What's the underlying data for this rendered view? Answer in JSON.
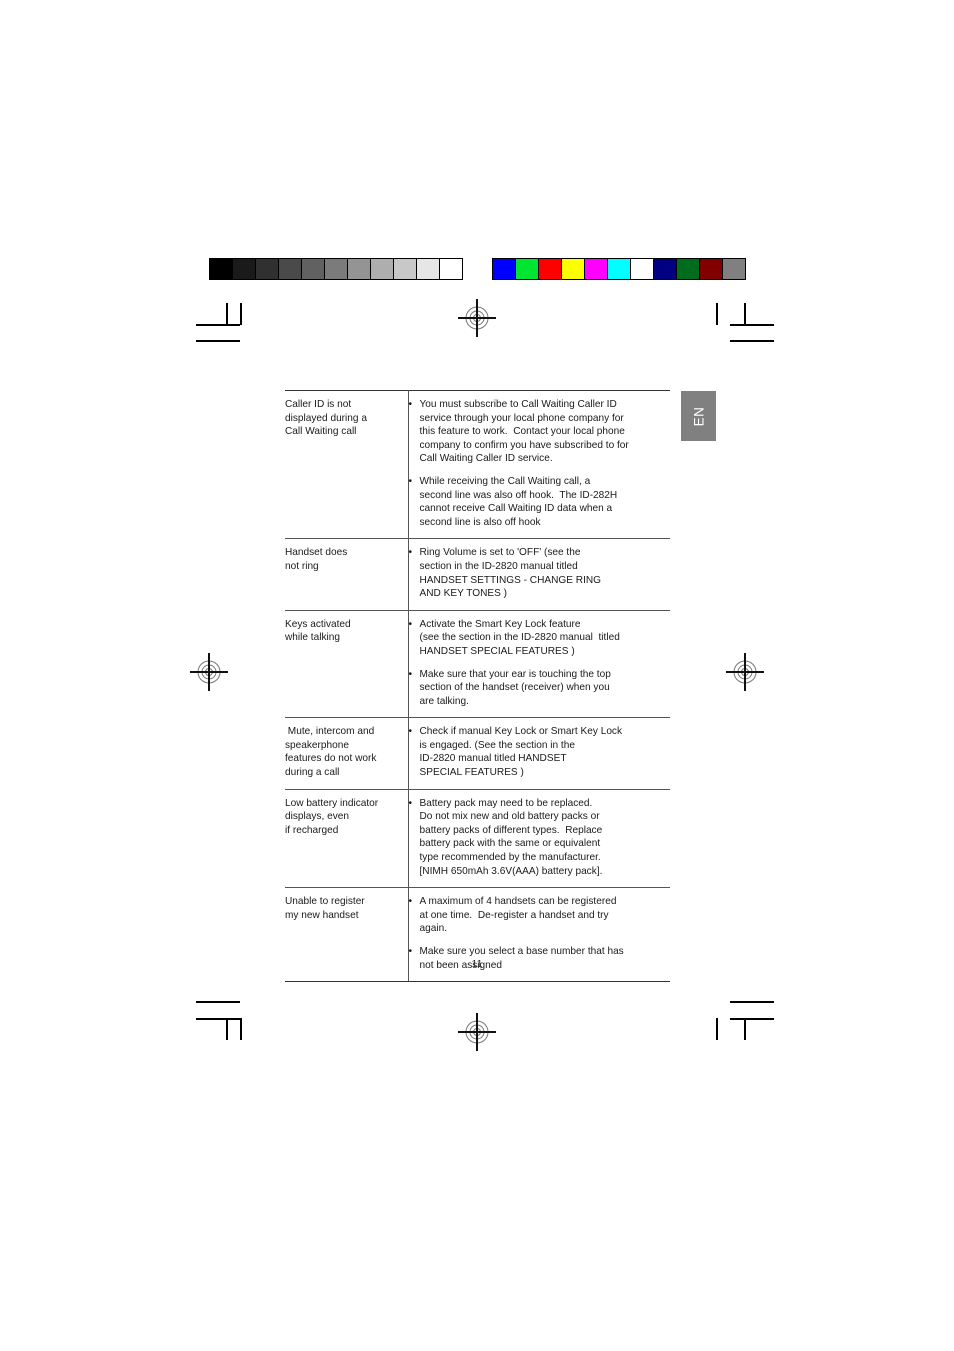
{
  "page": {
    "number": "11",
    "language_tab": "EN"
  },
  "calibration": {
    "grayscale_label": "grayscale-calibration-bar",
    "color_label": "color-calibration-bar",
    "grayscale_swatches": [
      "#000000",
      "#1a1a1a",
      "#303030",
      "#4a4a4a",
      "#616161",
      "#7b7b7b",
      "#949494",
      "#aeaeae",
      "#c8c8c8",
      "#e6e6e6",
      "#ffffff"
    ],
    "color_swatches": [
      "#0000ff",
      "#00e432",
      "#fe0000",
      "#ffff00",
      "#ff00ff",
      "#00ffff",
      "#ffffff",
      "#000080",
      "#006c1d",
      "#800000",
      "#808080"
    ]
  },
  "table": {
    "rows": [
      {
        "symptom": [
          "Caller ID is not",
          "displayed during a",
          "Call Waiting call"
        ],
        "solutions": [
          [
            "You must subscribe to Call Waiting Caller ID",
            "service through your local phone company for",
            "this feature to work.  Contact your local phone",
            "company to confirm you have subscribed to for",
            "Call Waiting Caller ID service."
          ],
          [
            "While receiving the Call Waiting call, a",
            "second line was also off hook.  The ID-282H",
            "cannot receive Call Waiting ID data when a",
            "second line is also off hook"
          ]
        ]
      },
      {
        "symptom": [
          "Handset does",
          "not ring"
        ],
        "solutions": [
          [
            "Ring Volume is set to 'OFF' (see the",
            "section in the ID-2820 manual titled",
            "HANDSET SETTINGS - CHANGE RING",
            "AND KEY TONES )"
          ]
        ]
      },
      {
        "symptom": [
          "Keys activated",
          "while talking"
        ],
        "solutions": [
          [
            "Activate the Smart Key Lock feature",
            "(see the section in the ID-2820 manual  titled",
            "HANDSET SPECIAL FEATURES )"
          ],
          [
            "Make sure that your ear is touching the top",
            "section of the handset (receiver) when you",
            "are talking."
          ]
        ]
      },
      {
        "symptom": [
          " Mute, intercom and",
          "speakerphone",
          "features do not work",
          "during a call"
        ],
        "solutions": [
          [
            "Check if manual Key Lock or Smart Key Lock",
            "is engaged. (See the section in the",
            "ID-2820 manual titled HANDSET",
            "SPECIAL FEATURES )"
          ]
        ]
      },
      {
        "symptom": [
          "Low battery indicator",
          "displays, even",
          "if recharged"
        ],
        "solutions": [
          [
            "Battery pack may need to be replaced.",
            "Do not mix new and old battery packs or",
            "battery packs of different types.  Replace",
            "battery pack with the same or equivalent",
            "type recommended by the manufacturer.",
            "[NIMH 650mAh 3.6V(AAA) battery pack]."
          ]
        ]
      },
      {
        "symptom": [
          "Unable to register",
          "my new handset"
        ],
        "solutions": [
          [
            "A maximum of 4 handsets can be registered",
            "at one time.  De-register a handset and try",
            "again."
          ],
          [
            "Make sure you select a base number that has",
            "not been assigned"
          ]
        ]
      }
    ],
    "bullet_glyph": "•"
  }
}
